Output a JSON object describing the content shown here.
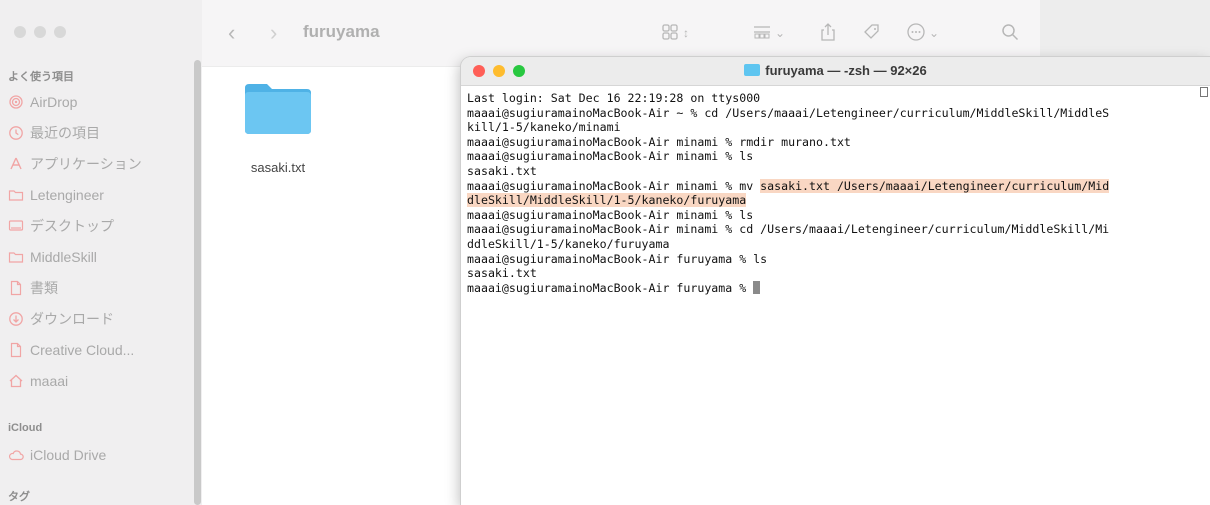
{
  "finder": {
    "window_title": "furuyama",
    "sidebar": {
      "sections": [
        {
          "label": "よく使う項目"
        },
        {
          "label": "iCloud"
        },
        {
          "label": "タグ"
        }
      ],
      "favorites": [
        {
          "label": "AirDrop",
          "icon": "airdrop-icon"
        },
        {
          "label": "最近の項目",
          "icon": "clock-icon"
        },
        {
          "label": "アプリケーション",
          "icon": "apps-icon"
        },
        {
          "label": "Letengineer",
          "icon": "folder-icon"
        },
        {
          "label": "デスクトップ",
          "icon": "desktop-icon"
        },
        {
          "label": "MiddleSkill",
          "icon": "folder-icon"
        },
        {
          "label": "書類",
          "icon": "document-icon"
        },
        {
          "label": "ダウンロード",
          "icon": "download-icon"
        },
        {
          "label": "Creative Cloud...",
          "icon": "document-icon"
        },
        {
          "label": "maaai",
          "icon": "home-icon"
        }
      ],
      "icloud": [
        {
          "label": "iCloud Drive",
          "icon": "cloud-icon"
        }
      ]
    },
    "files": [
      {
        "name": "sasaki.txt",
        "icon": "folder-icon"
      }
    ]
  },
  "terminal": {
    "title": "furuyama — -zsh — 92×26",
    "lines": [
      "Last login: Sat Dec 16 22:19:28 on ttys000",
      "maaai@sugiuramainoMacBook-Air ~ % cd /Users/maaai/Letengineer/curriculum/MiddleSkill/MiddleS",
      "kill/1-5/kaneko/minami",
      "maaai@sugiuramainoMacBook-Air minami % rmdir murano.txt",
      "maaai@sugiuramainoMacBook-Air minami % ls",
      "sasaki.txt",
      "maaai@sugiuramainoMacBook-Air minami % mv ",
      "sasaki.txt /Users/maaai/Letengineer/curriculum/Mid",
      "dleSkill/MiddleSkill/1-5/kaneko/furuyama",
      "maaai@sugiuramainoMacBook-Air minami % ls",
      "maaai@sugiuramainoMacBook-Air minami % cd /Users/maaai/Letengineer/curriculum/MiddleSkill/Mi",
      "ddleSkill/1-5/kaneko/furuyama",
      "maaai@sugiuramainoMacBook-Air furuyama % ls",
      "sasaki.txt",
      "maaai@sugiuramainoMacBook-Air furuyama % "
    ],
    "highlight_color": "#f9d7c3"
  },
  "colors": {
    "close": "#ff5f57",
    "minimize": "#febc2e",
    "zoom": "#28c840",
    "folder": "#5ec5f0"
  }
}
